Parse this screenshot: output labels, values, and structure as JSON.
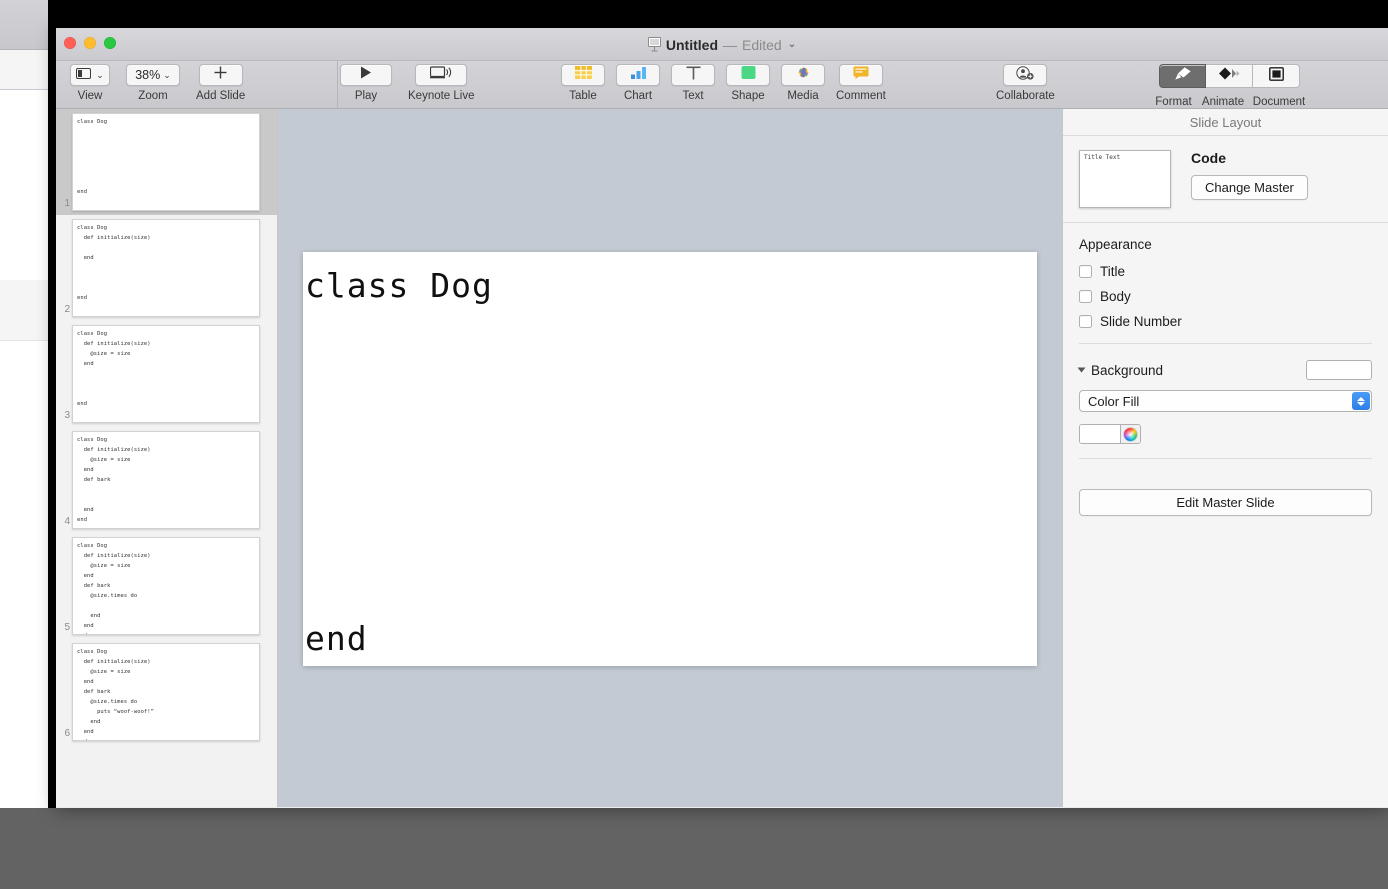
{
  "window": {
    "title": "Untitled",
    "separator": "—",
    "edited": "Edited",
    "chevron": "⌄",
    "doc_icon": "keynote-document-icon",
    "traffic_lights": [
      "close-button",
      "minimize-button",
      "zoom-button"
    ]
  },
  "toolbar": {
    "left": [
      {
        "name": "view",
        "label": "View",
        "icon": "view-panel-icon",
        "chevron": "⌄"
      },
      {
        "name": "zoom",
        "label": "Zoom",
        "value": "38%",
        "chevron": "⌄"
      },
      {
        "name": "add-slide",
        "label": "Add Slide",
        "icon": "plus-icon"
      }
    ],
    "play_group": [
      {
        "name": "play",
        "label": "Play",
        "icon": "play-triangle-icon"
      },
      {
        "name": "keynote-live",
        "label": "Keynote Live",
        "icon": "display-broadcast-icon"
      }
    ],
    "insert_group": [
      {
        "name": "table",
        "label": "Table",
        "icon": "table-grid-icon",
        "color": "#f5c33b"
      },
      {
        "name": "chart",
        "label": "Chart",
        "icon": "bar-chart-icon",
        "color": "#3b9ae1"
      },
      {
        "name": "text",
        "label": "Text",
        "icon": "text-t-icon",
        "color": "#6e6e6e"
      },
      {
        "name": "shape",
        "label": "Shape",
        "icon": "green-square-shape-icon",
        "color": "#4cd787"
      },
      {
        "name": "media",
        "label": "Media",
        "icon": "photos-flower-icon",
        "color": "#ff3b30"
      },
      {
        "name": "comment",
        "label": "Comment",
        "icon": "comment-bubble-icon",
        "color": "#f0b429"
      }
    ],
    "collaborate": {
      "name": "collaborate",
      "label": "Collaborate",
      "icon": "add-person-icon"
    },
    "inspector_tabs": [
      {
        "name": "format",
        "label": "Format",
        "icon": "paintbrush-icon",
        "active": true
      },
      {
        "name": "animate",
        "label": "Animate",
        "icon": "diamond-motion-icon",
        "active": false
      },
      {
        "name": "document",
        "label": "Document",
        "icon": "document-square-icon",
        "active": false
      }
    ]
  },
  "navigator": {
    "selected_index": 0,
    "slides": [
      {
        "number": "1",
        "code": "class Dog\n\n\n\n\n\n\nend"
      },
      {
        "number": "2",
        "code": "class Dog\n  def initialize(size)\n\n  end\n\n\n\nend"
      },
      {
        "number": "3",
        "code": "class Dog\n  def initialize(size)\n    @size = size\n  end\n\n\n\nend"
      },
      {
        "number": "4",
        "code": "class Dog\n  def initialize(size)\n    @size = size\n  end\n  def bark\n\n\n  end\nend"
      },
      {
        "number": "5",
        "code": "class Dog\n  def initialize(size)\n    @size = size\n  end\n  def bark\n    @size.times do\n\n    end\n  end\nend"
      },
      {
        "number": "6",
        "code": "class Dog\n  def initialize(size)\n    @size = size\n  end\n  def bark\n    @size.times do\n      puts “woof-woof!”\n    end\n  end\nend"
      }
    ]
  },
  "canvas": {
    "code_top": "class Dog",
    "code_bottom": "end",
    "background_color": "#c3cad3",
    "slide_color": "#ffffff"
  },
  "inspector": {
    "title": "Slide Layout",
    "master": {
      "thumb_text": "Title Text",
      "name": "Code",
      "change_button": "Change Master"
    },
    "appearance": {
      "title": "Appearance",
      "checkboxes": [
        {
          "label": "Title",
          "checked": false
        },
        {
          "label": "Body",
          "checked": false
        },
        {
          "label": "Slide Number",
          "checked": false
        }
      ]
    },
    "background": {
      "title": "Background",
      "disclosure": "triangle-down-icon",
      "preview_color": "#ffffff",
      "fill_type": "Color Fill",
      "fill_color": "#ffffff",
      "color_wheel_icon": "color-wheel-icon",
      "stepper_color": "#2d7fe8"
    },
    "edit_master_button": "Edit Master Slide"
  }
}
